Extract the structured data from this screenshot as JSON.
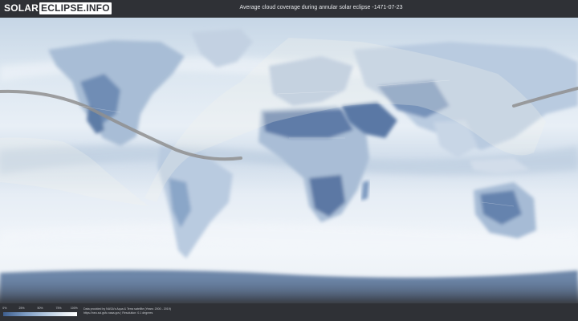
{
  "header": {
    "logo_part1": "SOLAR",
    "logo_part2": "ECLIPSE.INFO",
    "title": "Average cloud coverage during annular solar eclipse -1471-07-23"
  },
  "legend": {
    "ticks": [
      "0%",
      "25%",
      "50%",
      "75%",
      "100%"
    ],
    "colors": [
      "#3e5f8f",
      "#7d9cc4",
      "#b9cde2",
      "#e9eff5",
      "#ffffff"
    ]
  },
  "credits": {
    "line1": "Data provided by NASA's Aqua & Terra satellite (Years: 2000 - 2019)",
    "line2": "https://neo.sci.gsfc.nasa.gov | Resolution: 0.1 degrees"
  },
  "colors": {
    "background": "#2f3136",
    "ocean_cloud": "#d7e3ee",
    "clear_sky": "#5b79a6",
    "eclipse_path": "#8f8f8f"
  }
}
